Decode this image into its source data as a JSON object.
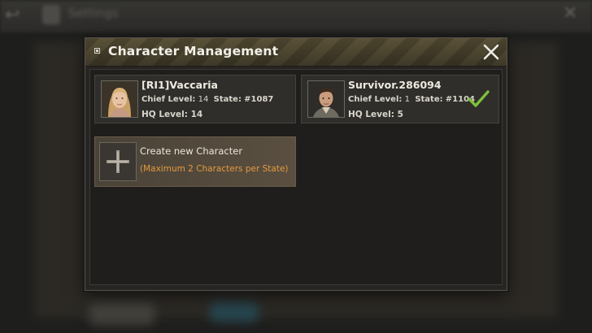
{
  "background": {
    "title": "Settings"
  },
  "dialog": {
    "title": "Character Management",
    "close_icon": "close-x-icon"
  },
  "characters": [
    {
      "name": "[RI1]Vaccaria",
      "chief_level_label": "Chief Level:",
      "chief_level": "14",
      "state_label": "State:",
      "state": "#1087",
      "hq_level_label": "HQ Level:",
      "hq_level": "14",
      "avatar": "female-blonde-portrait",
      "selected": false
    },
    {
      "name": "Survivor.286094",
      "chief_level_label": "Chief Level:",
      "chief_level": "1",
      "state_label": "State:",
      "state": "#1104",
      "hq_level_label": "HQ Level:",
      "hq_level": "5",
      "avatar": "male-dark-hair-portrait",
      "selected": true,
      "selected_icon": "checkmark-icon"
    }
  ],
  "create": {
    "label": "Create new Character",
    "note": "(Maximum 2 Characters per State)",
    "icon": "plus-icon"
  },
  "colors": {
    "accent_orange": "#e59a3f",
    "check_green": "#7fbf3a",
    "panel_dark": "#262523"
  }
}
